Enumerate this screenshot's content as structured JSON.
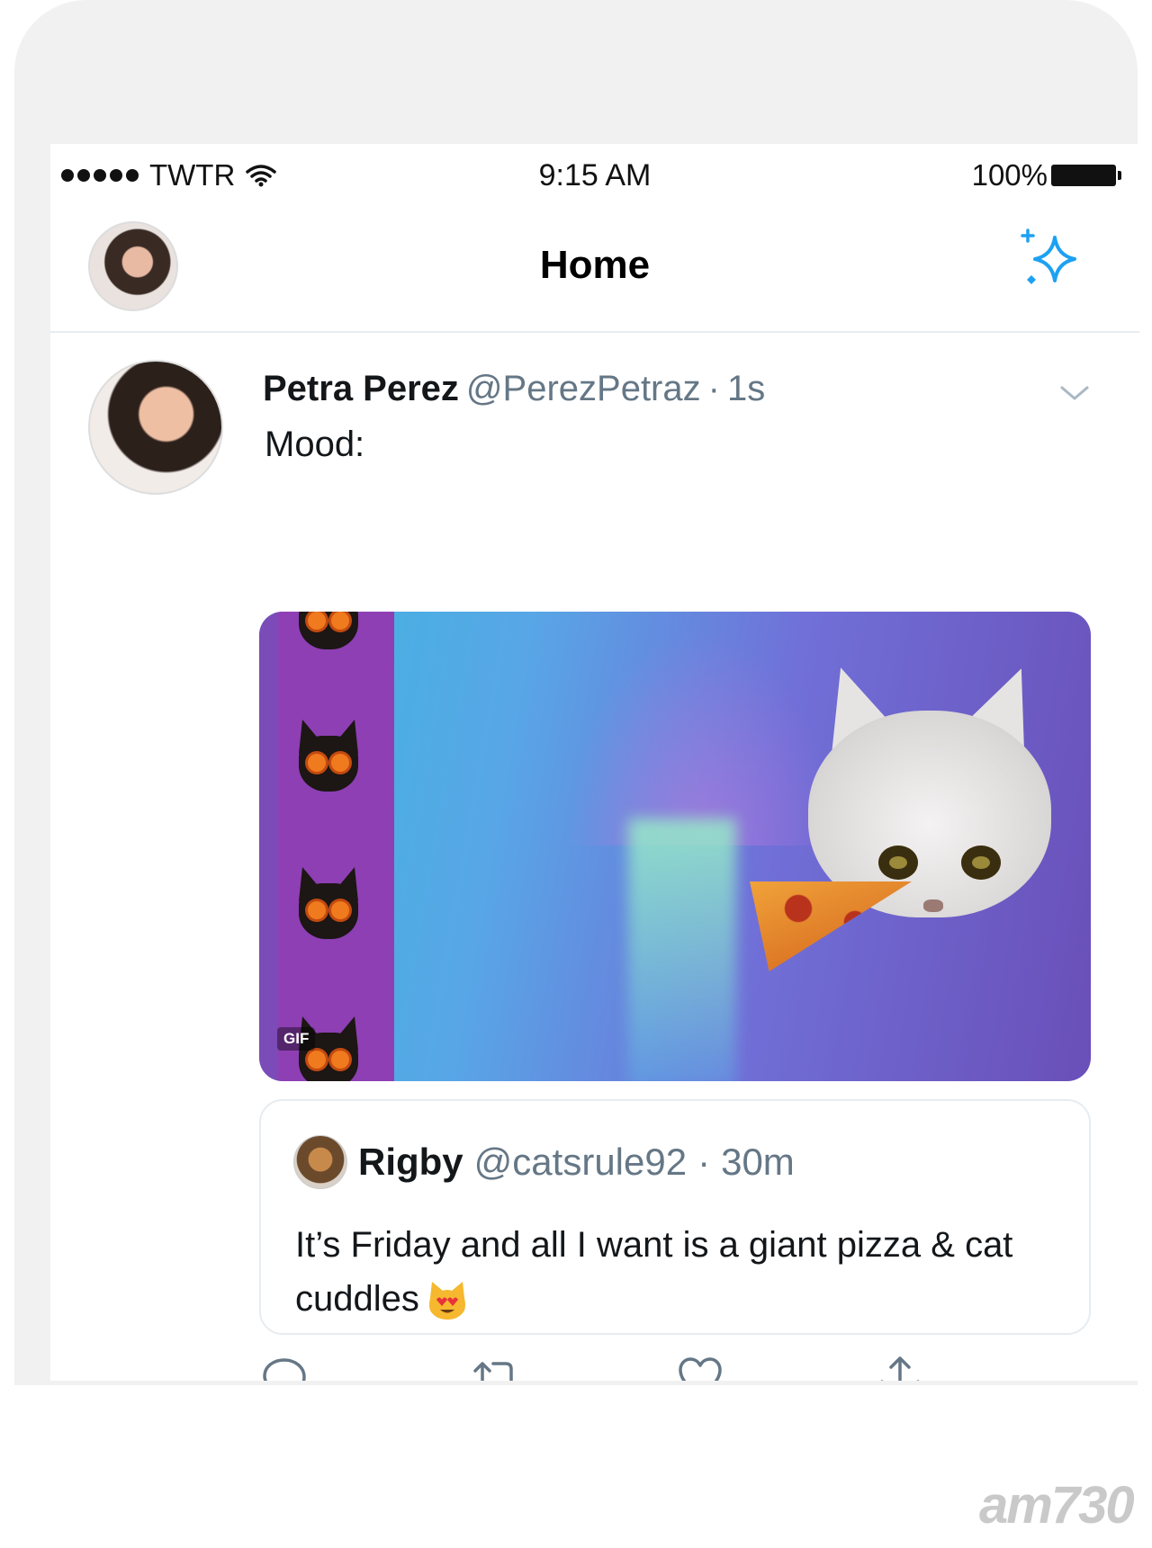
{
  "status_bar": {
    "carrier": "TWTR",
    "time": "9:15 AM",
    "battery_percent": "100%"
  },
  "nav": {
    "title": "Home"
  },
  "tweet": {
    "name": "Petra Perez",
    "handle": "@PerezPetraz",
    "separator": "·",
    "time": "1s",
    "text": "Mood:",
    "media_badge": "GIF"
  },
  "quoted_tweet": {
    "name": "Rigby",
    "handle": "@catsrule92",
    "separator": "·",
    "time": "30m",
    "text": "It’s Friday and all I want is a giant pizza & cat cuddles"
  },
  "actions": [
    "reply-icon",
    "retweet-icon",
    "like-icon",
    "share-icon"
  ],
  "watermark": "am730",
  "colors": {
    "accent": "#1da1f2",
    "secondary_text": "#657786",
    "divider": "#e6ecf0"
  }
}
